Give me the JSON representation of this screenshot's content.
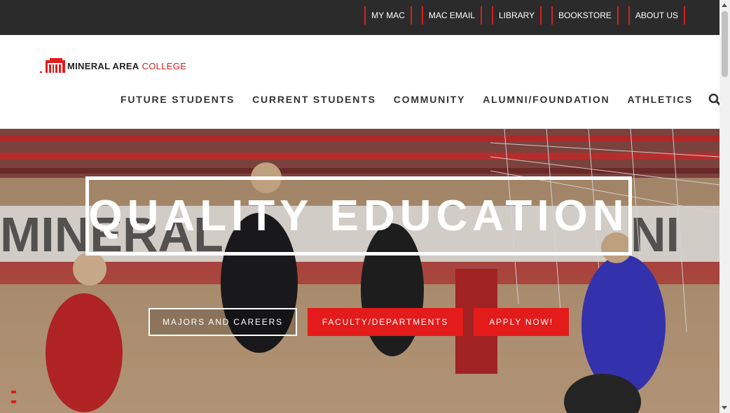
{
  "topbar": {
    "links": [
      "MY MAC",
      "MAC EMAIL",
      "LIBRARY",
      "BOOKSTORE",
      "ABOUT US"
    ]
  },
  "header": {
    "logo": {
      "part1": "MINERAL AREA",
      "part2": "COLLEGE"
    },
    "nav": [
      "FUTURE STUDENTS",
      "CURRENT STUDENTS",
      "COMMUNITY",
      "ALUMNI/FOUNDATION",
      "ATHLETICS"
    ],
    "search_icon": "search-icon"
  },
  "hero": {
    "title": "QUALITY EDUCATION",
    "buttons": [
      "MAJORS AND CAREERS",
      "FACULTY/DEPARTMENTS",
      "APPLY NOW!"
    ],
    "background": "volleyball-game-photo"
  },
  "colors": {
    "brand_red": "#e31b1b",
    "topbar": "#2b2b2b"
  }
}
